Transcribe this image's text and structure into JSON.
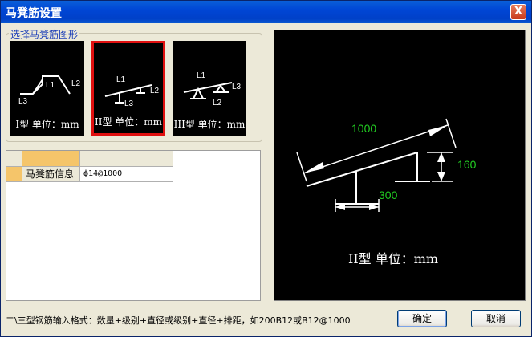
{
  "window": {
    "title": "马凳筋设置",
    "close_symbol": "X"
  },
  "group": {
    "label": "选择马凳筋图形"
  },
  "thumbnails": [
    {
      "caption": "I型 单位：mm",
      "labels": [
        "L1",
        "L2",
        "L3"
      ]
    },
    {
      "caption": "II型 单位：mm",
      "labels": [
        "L1",
        "L2",
        "L3"
      ]
    },
    {
      "caption": "III型 单位：mm",
      "labels": [
        "L1",
        "L2",
        "L3"
      ]
    }
  ],
  "grid": {
    "row_label": "马凳筋信息",
    "row_value": "ф14@1000"
  },
  "preview": {
    "dim_length": "1000",
    "dim_height": "160",
    "dim_base": "300",
    "caption": "II型 单位：mm"
  },
  "status": {
    "hint": "二\\三型钢筋输入格式：数量+级别+直径或级别+直径+排距，如200B12或B12@1000"
  },
  "buttons": {
    "ok": "确定",
    "cancel": "取消"
  },
  "colors": {
    "accent_selected": "#E01010",
    "dim_text": "#22CC22",
    "title_bar": "#0046D5"
  }
}
